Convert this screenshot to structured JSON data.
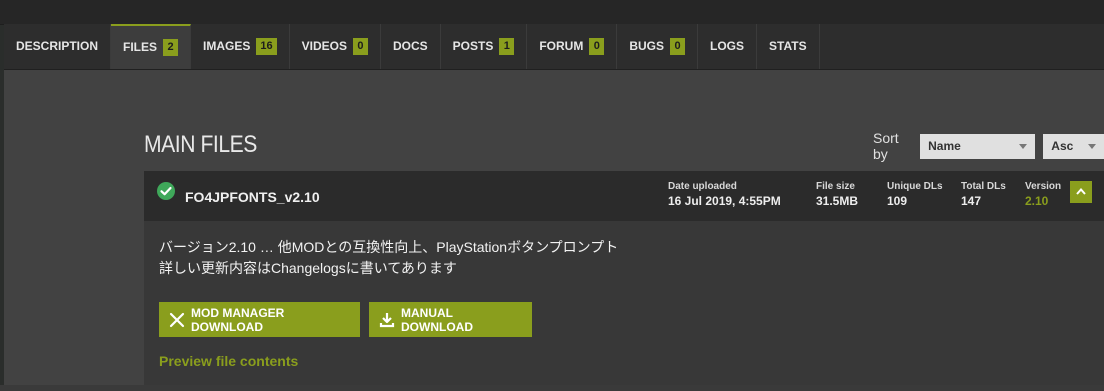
{
  "tabs": [
    {
      "label": "DESCRIPTION",
      "count": null,
      "active": false
    },
    {
      "label": "FILES",
      "count": "2",
      "active": true
    },
    {
      "label": "IMAGES",
      "count": "16",
      "active": false
    },
    {
      "label": "VIDEOS",
      "count": "0",
      "active": false
    },
    {
      "label": "DOCS",
      "count": null,
      "active": false
    },
    {
      "label": "POSTS",
      "count": "1",
      "active": false
    },
    {
      "label": "FORUM",
      "count": "0",
      "active": false
    },
    {
      "label": "BUGS",
      "count": "0",
      "active": false
    },
    {
      "label": "LOGS",
      "count": null,
      "active": false
    },
    {
      "label": "STATS",
      "count": null,
      "active": false
    }
  ],
  "section": {
    "title": "MAIN FILES"
  },
  "sort": {
    "label": "Sort by",
    "field": "Name",
    "order": "Asc"
  },
  "file": {
    "name": "FO4JPFONTS_v2.10",
    "date_label": "Date uploaded",
    "date_value": "16 Jul 2019, 4:55PM",
    "size_label": "File size",
    "size_value": "31.5MB",
    "unique_label": "Unique DLs",
    "unique_value": "109",
    "total_label": "Total DLs",
    "total_value": "147",
    "version_label": "Version",
    "version_value": "2.10",
    "description_line1": "バージョン2.10 … 他MODとの互換性向上、PlayStationボタンプロンプト",
    "description_line2": "詳しい更新内容はChangelogsに書いてあります",
    "mod_manager_label": "MOD MANAGER DOWNLOAD",
    "manual_label": "MANUAL DOWNLOAD",
    "preview_label": "Preview file contents"
  },
  "colors": {
    "accent": "#8a9e1d",
    "check": "#3fa85a"
  }
}
